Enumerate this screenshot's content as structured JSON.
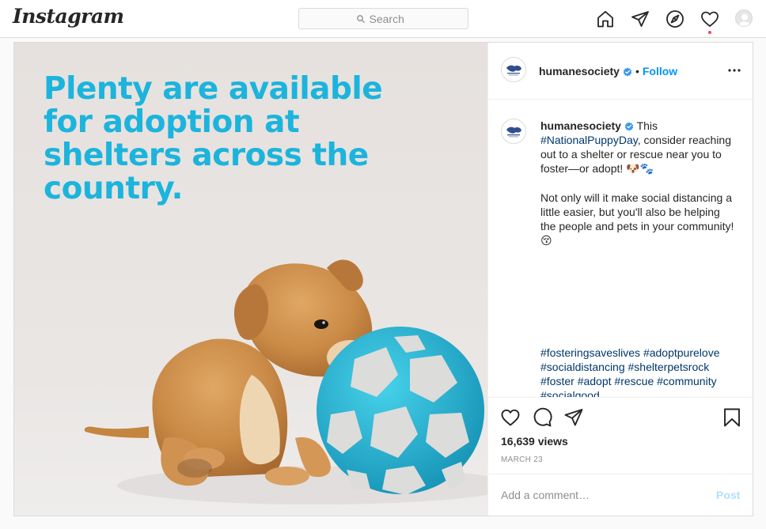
{
  "app": {
    "name": "Instagram"
  },
  "search": {
    "placeholder": "Search"
  },
  "post": {
    "image_headline": "Plenty are available for adoption at shelters across the country.",
    "username": "humanesociety",
    "follow_label": "Follow",
    "caption": {
      "line1_after_user": " This",
      "hashtag1": "#NationalPuppyDay",
      "line1_rest": ", consider reaching out to a shelter or rescue near you to foster—or adopt! ",
      "line1_emoji": "🐶🐾",
      "paragraph2": "Not only will it make social distancing a little easier, but you'll also be helping the people and pets in your community! ",
      "paragraph2_emoji": "😚"
    },
    "hashtags": [
      "#fosteringsaveslives",
      "#adoptpurelove",
      "#socialdistancing",
      "#shelterpetsrock",
      "#foster",
      "#adopt",
      "#rescue",
      "#community",
      "#socialgood"
    ],
    "views": "16,639 views",
    "date": "MARCH 23",
    "comment_placeholder": "Add a comment…",
    "post_button": "Post"
  },
  "colors": {
    "accent_blue": "#0095f6",
    "headline_cyan": "#1cb4dc",
    "hashtag": "#00376b",
    "notification_dot": "#ed4956"
  },
  "icons": {
    "nav": [
      "home-icon",
      "direct-icon",
      "explore-icon",
      "activity-heart-icon",
      "profile-avatar"
    ],
    "actions": [
      "like-heart-icon",
      "comment-icon",
      "share-icon",
      "save-bookmark-icon"
    ]
  }
}
